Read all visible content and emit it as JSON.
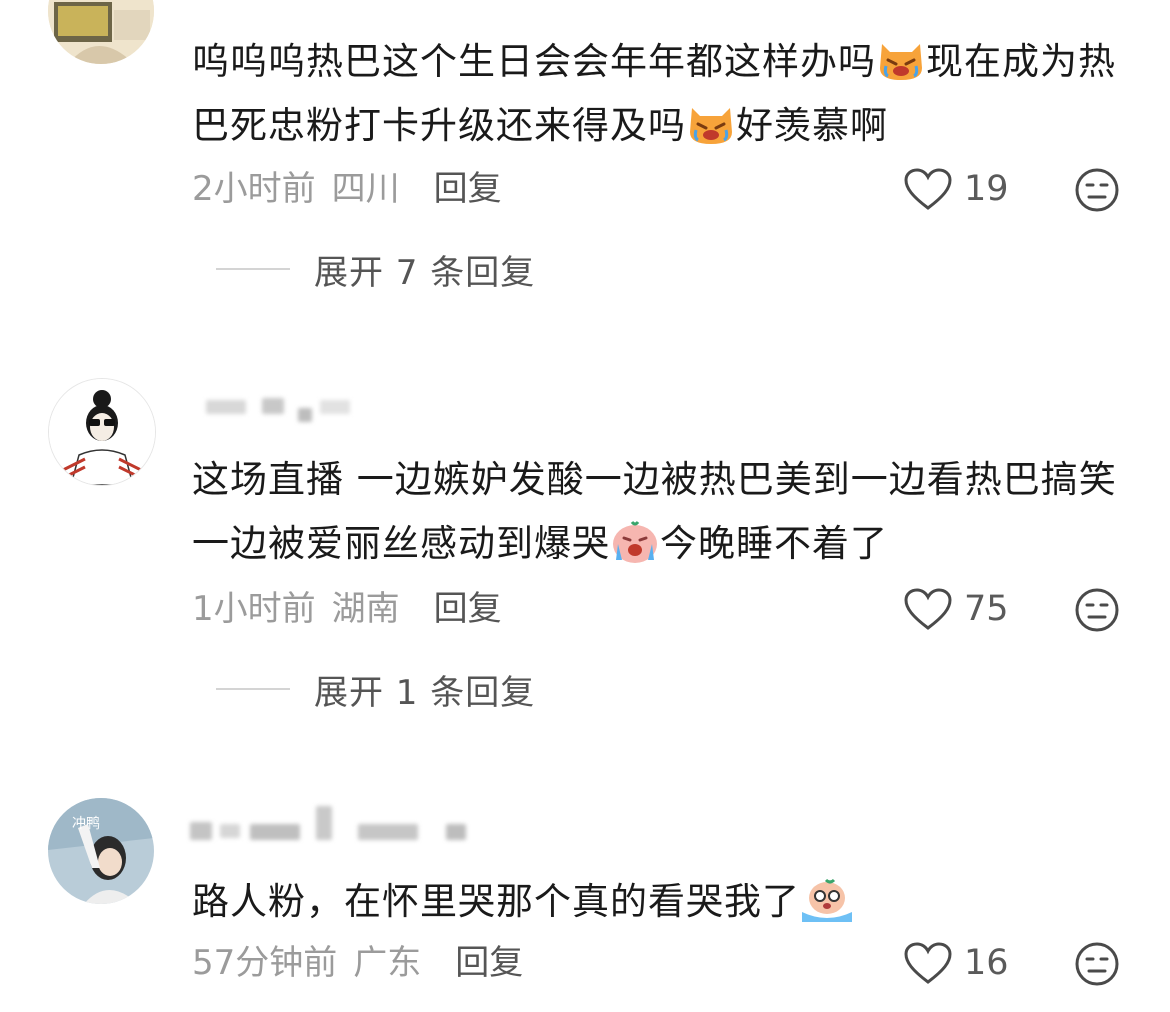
{
  "comments": [
    {
      "text_parts": [
        "呜呜呜热巴这个生日会会年年都这样办吗",
        "现在成为热巴死忠粉打卡升级还来得及吗",
        "好羡慕啊"
      ],
      "emoji": "crying-cat-emoji",
      "time": "2小时前",
      "location": "四川",
      "reply_label": "回复",
      "likes": "19",
      "expand_label": "展开 7 条回复"
    },
    {
      "text_parts": [
        "这场直播 一边嫉妒发酸一边被热巴美到一边看热巴搞笑一边被爱丽丝感动到爆哭",
        "今晚睡不着了"
      ],
      "emoji": "crying-face-emoji",
      "time": "1小时前",
      "location": "湖南",
      "reply_label": "回复",
      "likes": "75",
      "expand_label": "展开 1 条回复"
    },
    {
      "text_parts": [
        "路人粉，在怀里哭那个真的看哭我了"
      ],
      "emoji": "sobbing-emoji",
      "time": "57分钟前",
      "location": "广东",
      "reply_label": "回复",
      "likes": "16",
      "avatar_text": "冲鸭"
    }
  ],
  "colors": {
    "text": "#1a1a1a",
    "meta": "#9b9b9b",
    "action": "#555555",
    "emoji_cat": "#f7a33a",
    "emoji_face": "#f4a3a3"
  }
}
